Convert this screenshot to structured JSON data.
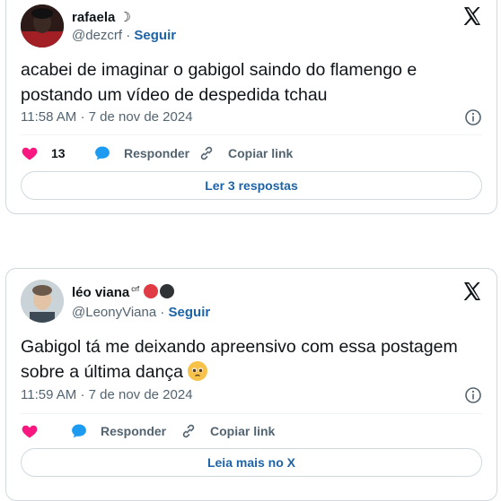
{
  "tweets": [
    {
      "author_name": "rafaela",
      "author_suffix": "☽",
      "handle": "@dezcrf",
      "separator": "·",
      "follow_label": "Seguir",
      "text_line1": "acabei de imaginar o gabigol saindo do flamengo e",
      "text_line2": "postando um vídeo de despedida tchau",
      "time": "11:58 AM",
      "date": "7 de nov de 2024",
      "like_count": "13",
      "reply_label": "Responder",
      "copy_label": "Copiar link",
      "footer_button": "Ler 3 respostas"
    },
    {
      "author_name": "léo viana",
      "author_suffix": "crf",
      "handle": "@LeonyViana",
      "separator": "·",
      "follow_label": "Seguir",
      "text_line1": "Gabigol tá me deixando apreensivo com essa postagem",
      "text_line2": "sobre a última dança",
      "time": "11:59 AM",
      "date": "7 de nov de 2024",
      "like_count": "",
      "reply_label": "Responder",
      "copy_label": "Copiar link",
      "footer_button": "Leia mais no X"
    }
  ],
  "colors": {
    "like_red": "#f91880",
    "reply_blue": "#1d9bf0",
    "link_blue": "#1d63a8",
    "muted": "#536471",
    "border": "#cfd9de"
  },
  "icons": [
    "x-logo-icon",
    "info-icon",
    "heart-icon",
    "reply-bubble-icon",
    "link-icon",
    "pleading-face-emoji"
  ]
}
